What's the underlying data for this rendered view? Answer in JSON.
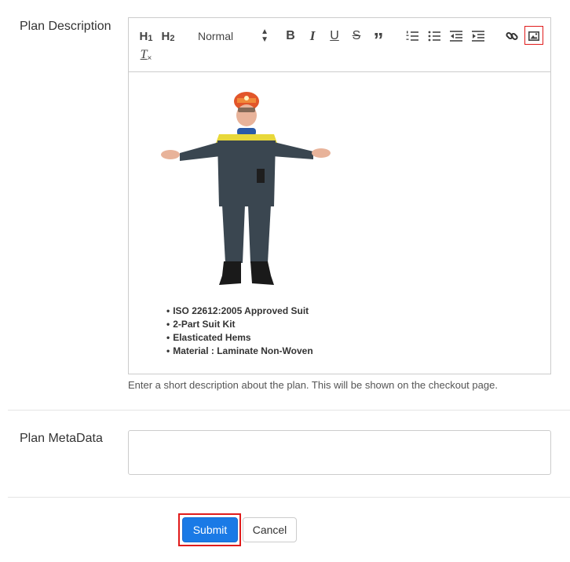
{
  "form": {
    "description_label": "Plan Description",
    "metadata_label": "Plan MetaData",
    "help_text": "Enter a short description about the plan. This will be shown on the checkout page."
  },
  "toolbar": {
    "h1": "H",
    "h1_sub": "1",
    "h2": "H",
    "h2_sub": "2",
    "format_select": "Normal",
    "bold": "B",
    "italic": "I",
    "underline": "U",
    "strike": "S",
    "quote": "”",
    "clear_format": "T"
  },
  "editor": {
    "bullets": [
      "ISO 22612:2005 Approved Suit",
      "2-Part Suit Kit",
      "Elasticated Hems",
      "Material : Laminate Non-Woven"
    ]
  },
  "buttons": {
    "submit": "Submit",
    "cancel": "Cancel"
  },
  "colors": {
    "accent": "#1a7ae6",
    "highlight": "#e01b1b"
  }
}
